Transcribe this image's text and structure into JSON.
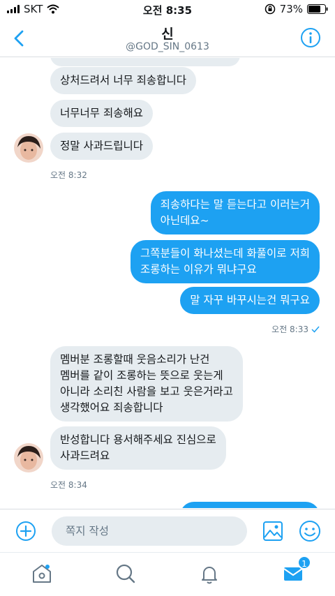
{
  "status_bar": {
    "carrier": "SKT",
    "time": "오전 8:35",
    "battery": "73%"
  },
  "header": {
    "name": "신",
    "handle": "@GOD_SIN_0613"
  },
  "messages": [
    {
      "text": "상처드려서 너무 죄송합니다"
    },
    {
      "text": "너무너무 죄송해요"
    },
    {
      "text": "정말 사과드립니다"
    },
    {
      "timestamp": "오전 8:32"
    },
    {
      "lines": [
        "죄송하다는 말 듣는다고 이러는거",
        "아닌데요~"
      ]
    },
    {
      "lines": [
        "그쪽분들이 화나셨는데 화풀이로 저희",
        "조롱하는 이유가 뭐냐구요"
      ]
    },
    {
      "text": "말 자꾸 바꾸시는건 뭐구요"
    },
    {
      "timestamp": "오전 8:33"
    },
    {
      "lines": [
        "멤버분 조롱할때 웃음소리가 난건",
        "멤버를 같이 조롱하는 뜻으로 웃는게",
        "아니라 소리친 사람을 보고 웃은거라고",
        "생각했어요 죄송합니다"
      ]
    },
    {
      "lines": [
        "반성합니다 용서해주세요 진심으로",
        "사과드려요"
      ]
    },
    {
      "timestamp": "오전 8:34"
    }
  ],
  "composer": {
    "placeholder": "쪽지 작성"
  },
  "tabbar": {
    "messages_badge": "1"
  },
  "colors": {
    "accent": "#1da1f2",
    "incoming_bubble": "#e6ecf0"
  }
}
